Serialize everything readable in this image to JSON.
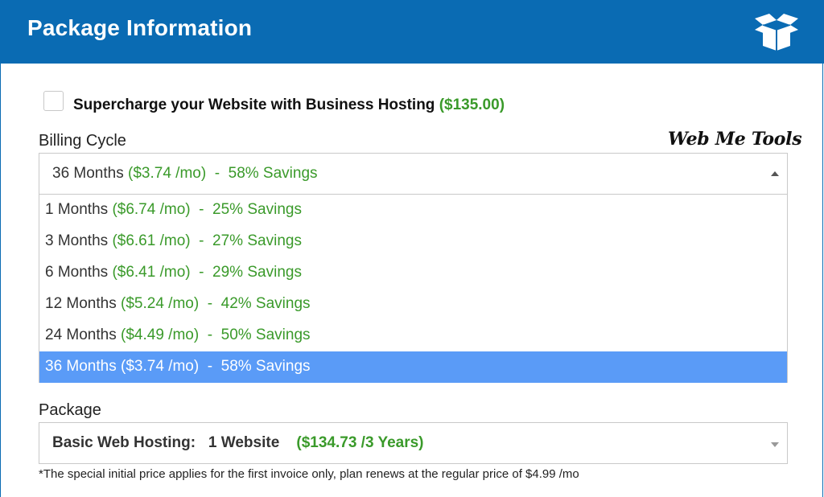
{
  "header": {
    "title": "Package Information",
    "icon": "open-box-icon",
    "background": "#0a6bb3"
  },
  "addon": {
    "checked": false,
    "label": "Supercharge your Website with Business Hosting",
    "price": "($135.00)"
  },
  "billing": {
    "label": "Billing Cycle",
    "watermark": "Web Me Tools",
    "selected": {
      "term": "36 Months",
      "price": "($3.74 /mo)",
      "sep": "  -  ",
      "savings": "58% Savings"
    },
    "options": [
      {
        "term": "1 Months",
        "price": "($6.74 /mo)",
        "sep": "  -  ",
        "savings": "25% Savings"
      },
      {
        "term": "3 Months",
        "price": "($6.61 /mo)",
        "sep": "  -  ",
        "savings": "27% Savings"
      },
      {
        "term": "6 Months",
        "price": "($6.41 /mo)",
        "sep": "  -  ",
        "savings": "29% Savings"
      },
      {
        "term": "12 Months",
        "price": "($5.24 /mo)",
        "sep": "  -  ",
        "savings": "42% Savings"
      },
      {
        "term": "24 Months",
        "price": "($4.49 /mo)",
        "sep": "  -  ",
        "savings": "50% Savings"
      },
      {
        "term": "36 Months",
        "price": "($3.74 /mo)",
        "sep": "  -  ",
        "savings": "58% Savings"
      }
    ],
    "selected_index": 5,
    "highlight_color": "#5a9bf7",
    "savings_color": "#3a9a2a"
  },
  "package": {
    "label": "Package",
    "name": "Basic Web Hosting:",
    "sites": "1 Website",
    "price": "($134.73 /3 Years)"
  },
  "note": "*The special initial price applies for the first invoice only, plan renews at the regular price of $4.99 /mo"
}
